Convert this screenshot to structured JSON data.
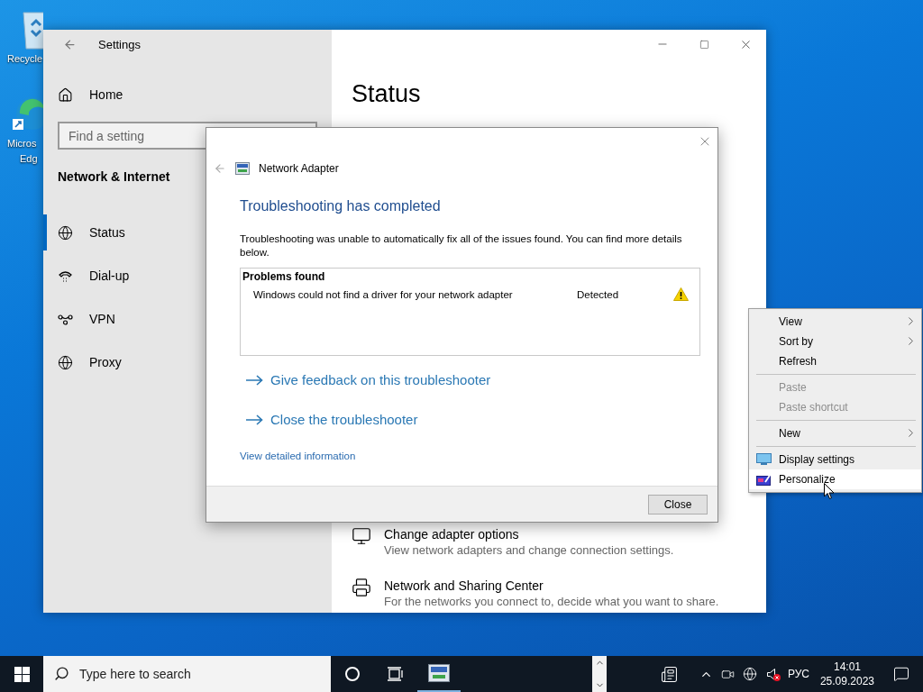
{
  "desktop": {
    "icons": [
      {
        "lines": [
          "Recycle"
        ]
      },
      {
        "lines": [
          "Micros",
          "Edg"
        ]
      }
    ]
  },
  "settings": {
    "title": "Settings",
    "home": "Home",
    "search": {
      "placeholder": "Find a setting"
    },
    "section": "Network & Internet",
    "items": [
      {
        "label": "Status",
        "selected": true
      },
      {
        "label": "Dial-up",
        "selected": false
      },
      {
        "label": "VPN",
        "selected": false
      },
      {
        "label": "Proxy",
        "selected": false
      }
    ],
    "page_title": "Status",
    "options": [
      {
        "title": "Change adapter options",
        "description": "View network adapters and change connection settings."
      },
      {
        "title": "Network and Sharing Center",
        "description": "For the networks you connect to, decide what you want to share."
      }
    ]
  },
  "dialog": {
    "title": "Network Adapter",
    "heading": "Troubleshooting has completed",
    "message": "Troubleshooting was unable to automatically fix all of the issues found. You can find more details below.",
    "problems": {
      "header": "Problems found",
      "rows": [
        {
          "problem": "Windows could not find a driver for your network adapter",
          "status": "Detected"
        }
      ]
    },
    "links": [
      "Give feedback on this troubleshooter",
      "Close the troubleshooter"
    ],
    "details_link": "View detailed information",
    "button": "Close"
  },
  "context_menu": {
    "items": [
      {
        "kind": "item",
        "label": "View",
        "disabled": false,
        "submenu": true,
        "selected": false
      },
      {
        "kind": "item",
        "label": "Sort by",
        "disabled": false,
        "submenu": true,
        "selected": false
      },
      {
        "kind": "item",
        "label": "Refresh",
        "disabled": false,
        "submenu": false,
        "selected": false
      },
      {
        "kind": "separator"
      },
      {
        "kind": "item",
        "label": "Paste",
        "disabled": true,
        "submenu": false,
        "selected": false
      },
      {
        "kind": "item",
        "label": "Paste shortcut",
        "disabled": true,
        "submenu": false,
        "selected": false
      },
      {
        "kind": "separator"
      },
      {
        "kind": "item",
        "label": "New",
        "disabled": false,
        "submenu": true,
        "selected": false
      },
      {
        "kind": "separator"
      },
      {
        "kind": "icon_item",
        "label": "Display settings",
        "disabled": false,
        "submenu": false,
        "selected": false
      },
      {
        "kind": "icon_item",
        "label": "Personalize",
        "disabled": false,
        "submenu": false,
        "selected": true
      }
    ]
  },
  "taskbar": {
    "search": {
      "placeholder": "Type here to search"
    },
    "tray": {
      "muted": true,
      "language": "РУС",
      "time": "14:01",
      "date": "25.09.2023"
    }
  }
}
